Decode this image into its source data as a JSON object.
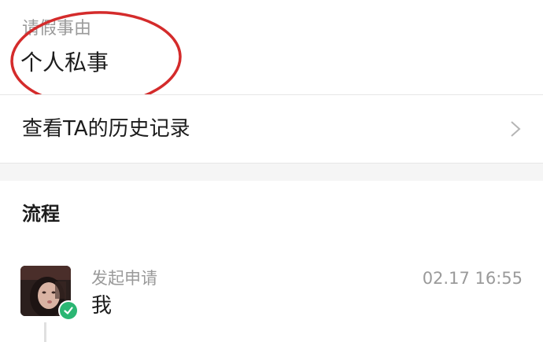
{
  "reason": {
    "label": "请假事由",
    "value": "个人私事",
    "annotation_color": "#d42b2b"
  },
  "history": {
    "label": "查看TA的历史记录",
    "icon": "chevron-right-icon"
  },
  "process": {
    "title": "流程",
    "steps": [
      {
        "action": "发起申请",
        "person": "我",
        "time": "02.17 16:55",
        "status_icon": "check-circle-icon",
        "status_color": "#2bb673"
      }
    ]
  }
}
